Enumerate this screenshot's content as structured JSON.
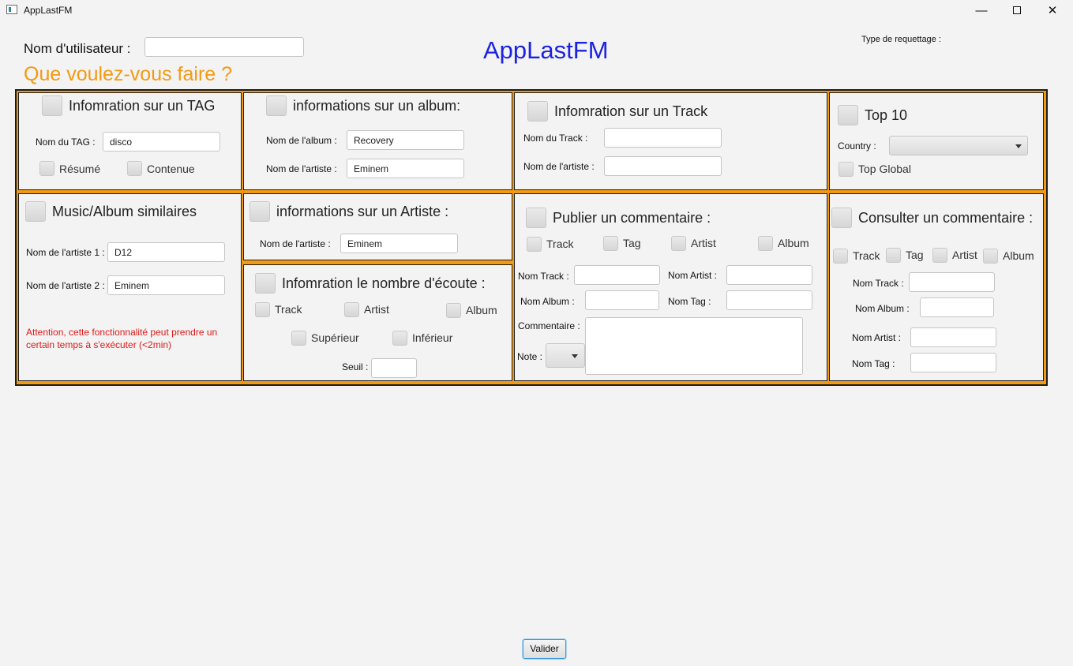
{
  "window": {
    "title": "AppLastFM",
    "min_symbol": "—",
    "close_symbol": "✕"
  },
  "header": {
    "username_label": "Nom d'utilisateur :",
    "username_value": "",
    "app_title": "AppLastFM",
    "question": "Que voulez-vous faire ?",
    "request_type_label": "Type de requettage :"
  },
  "tag_info": {
    "title": "Infomration sur un TAG",
    "tag_label": "Nom du TAG :",
    "tag_value": "disco",
    "summary_label": "Résumé",
    "content_label": "Contenue"
  },
  "album_info": {
    "title": "informations sur un album:",
    "album_label": "Nom de l'album :",
    "album_value": "Recovery",
    "artist_label": "Nom de l'artiste :",
    "artist_value": "Eminem"
  },
  "track_info": {
    "title": "Infomration sur un Track",
    "track_label": "Nom du Track :",
    "track_value": "",
    "artist_label": "Nom de l'artiste :",
    "artist_value": ""
  },
  "top10": {
    "title": "Top 10",
    "country_label": "Country :",
    "country_value": "",
    "global_label": "Top Global"
  },
  "similar": {
    "title": "Music/Album similaires",
    "artist1_label": "Nom de l'artiste 1 :",
    "artist1_value": "D12",
    "artist2_label": "Nom de l'artiste 2 :",
    "artist2_value": "Eminem",
    "warning": "Attention, cette fonctionnalité peut prendre un certain temps à s'exécuter (<2min)"
  },
  "artist_info": {
    "title": "informations sur un Artiste :",
    "artist_label": "Nom de l'artiste :",
    "artist_value": "Eminem"
  },
  "listens": {
    "title": "Infomration le nombre d'écoute :",
    "track_label": "Track",
    "artist_label": "Artist",
    "album_label": "Album",
    "superior_label": "Supérieur",
    "inferior_label": "Inférieur",
    "threshold_label": "Seuil :",
    "threshold_value": ""
  },
  "publish": {
    "title": "Publier un commentaire :",
    "track_label": "Track",
    "tag_label": "Tag",
    "artist_label": "Artist",
    "album_label": "Album",
    "track_field_label": "Nom Track :",
    "artist_field_label": "Nom Artist :",
    "album_field_label": "Nom Album :",
    "tag_field_label": "Nom Tag :",
    "comment_label": "Commentaire :",
    "note_label": "Note :"
  },
  "consult": {
    "title": "Consulter un commentaire :",
    "track_label": "Track",
    "tag_label": "Tag",
    "artist_label": "Artist",
    "album_label": "Album",
    "track_field_label": "Nom Track :",
    "album_field_label": "Nom Album :",
    "artist_field_label": "Nom Artist :",
    "tag_field_label": "Nom Tag :"
  },
  "footer": {
    "submit_label": "Valider"
  },
  "colors": {
    "accent_orange": "#f39a12",
    "title_blue": "#1c22e0",
    "warning_red": "#e01818"
  }
}
